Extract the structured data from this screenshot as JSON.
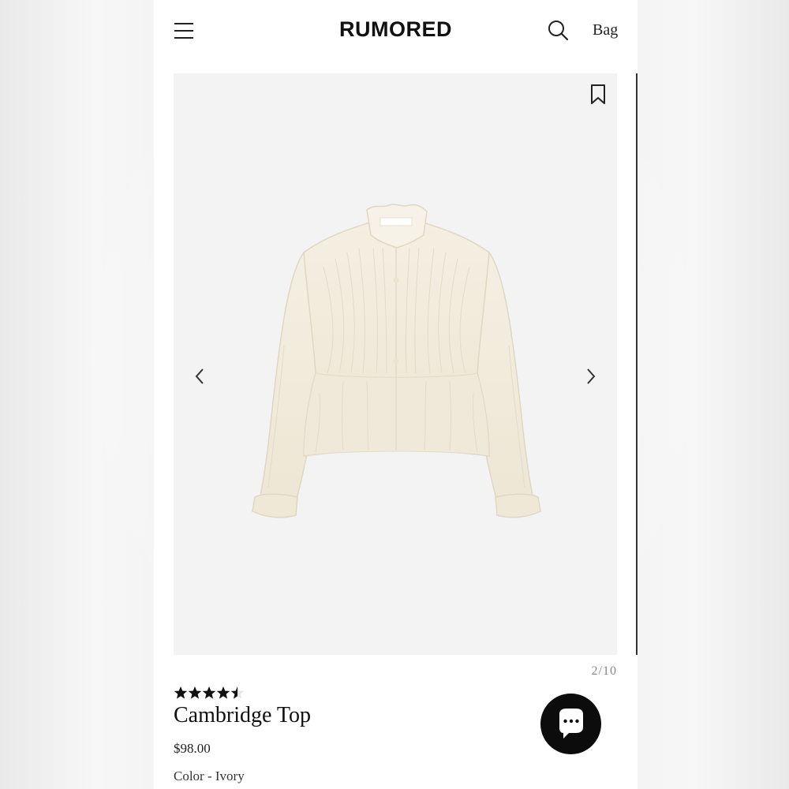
{
  "header": {
    "brand": "RUMORED",
    "bag_label": "Bag"
  },
  "gallery": {
    "counter": "2/10",
    "current_image": 2,
    "total_images": 10
  },
  "product": {
    "name": "Cambridge Top",
    "price": "$98.00",
    "color_label": "Color - Ivory",
    "rating": 4.5,
    "rating_max": 5
  },
  "icons": {
    "menu": "hamburger-menu-icon",
    "search": "search-icon",
    "bookmark": "bookmark-icon",
    "prev": "chevron-left-icon",
    "next": "chevron-right-icon",
    "chat": "chat-bubble-icon",
    "star": "star-icon"
  },
  "colors": {
    "accent": "#0c0c0c",
    "gallery_background": "#f3f3f3",
    "garment": "#f1ebdc",
    "star_filled": "#111111",
    "star_empty": "#e4e4e4"
  }
}
